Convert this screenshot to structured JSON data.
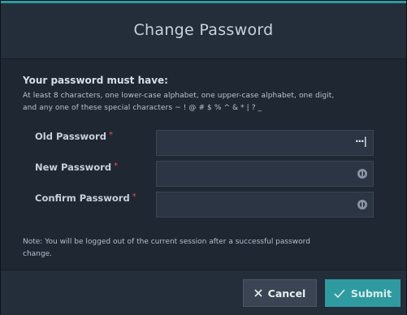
{
  "dialog": {
    "title": "Change Password",
    "requirements_heading": "Your password must have:",
    "requirements_line1": "At least 8 characters, one lower-case alphabet, one upper-case alphabet, one digit,",
    "requirements_line2": "and any one of these special characters ~ ! @ # $ % ^ & * | ? _",
    "fields": {
      "old_password": {
        "label": "Old Password",
        "required_mark": "*",
        "value": ""
      },
      "new_password": {
        "label": "New Password",
        "required_mark": "*",
        "value": ""
      },
      "confirm_password": {
        "label": "Confirm Password",
        "required_mark": "*",
        "value": ""
      }
    },
    "note_line1": "Note: You will be logged out of the current session after a successful password",
    "note_line2": "change.",
    "buttons": {
      "cancel": "Cancel",
      "submit": "Submit"
    },
    "colors": {
      "accent": "#2f9aa0",
      "required": "#e0554f",
      "background": "#1f2733"
    }
  }
}
